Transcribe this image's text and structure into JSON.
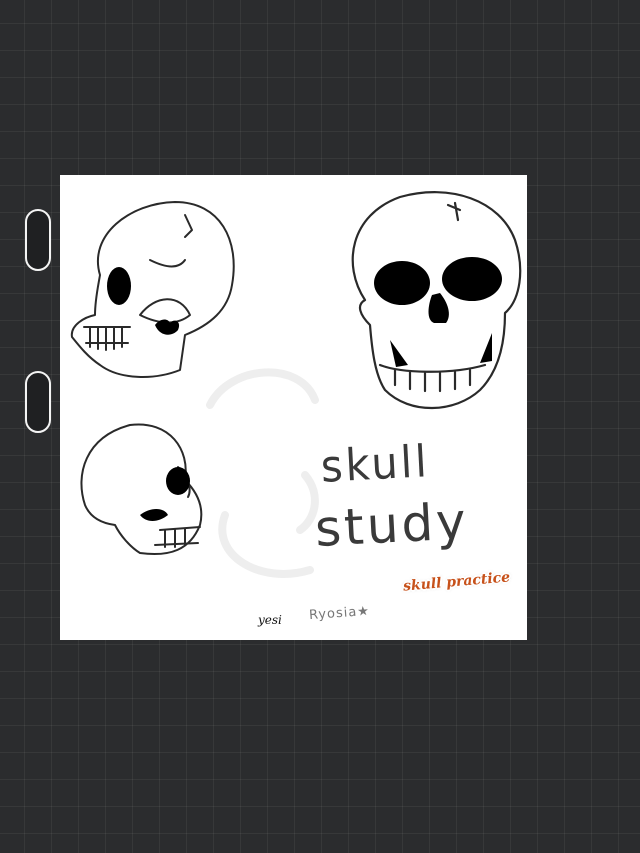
{
  "artwork": {
    "title_line1": "skull",
    "title_line2": "study",
    "sticker_text": "skull practice",
    "author": "yesi",
    "signature": "Ryosia★"
  },
  "icons": {
    "handle_top": "drag-handle-icon",
    "handle_bottom": "drag-handle-icon"
  },
  "colors": {
    "background": "#2b2c2e",
    "grid_line": "#3a3b3d",
    "canvas": "#ffffff",
    "sticker": "#c7511a",
    "ink": "#1a1a1a"
  }
}
